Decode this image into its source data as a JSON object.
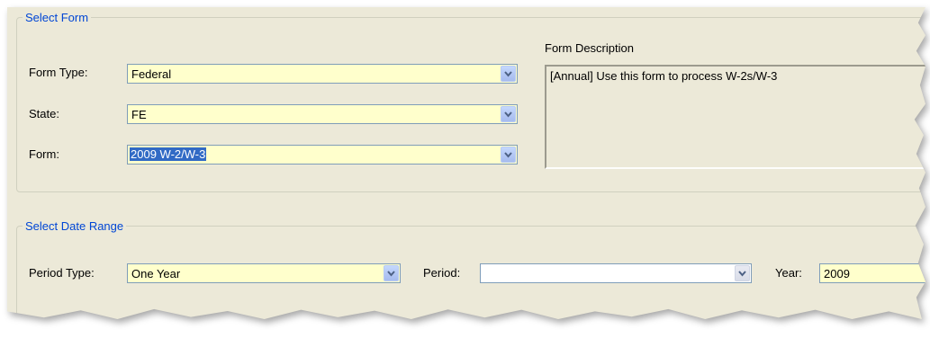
{
  "select_form": {
    "legend": "Select Form",
    "form_type_label": "Form Type:",
    "form_type_value": "Federal",
    "state_label": "State:",
    "state_value": "FE",
    "form_label": "Form:",
    "form_value": "2009 W-2/W-3",
    "description_label": "Form Description",
    "description_text": "[Annual] Use this form to process W-2s/W-3"
  },
  "select_date_range": {
    "legend": "Select Date Range",
    "period_type_label": "Period Type:",
    "period_type_value": "One Year",
    "period_label": "Period:",
    "period_value": "",
    "year_label": "Year:",
    "year_value": "2009"
  },
  "icons": {
    "dropdown": "chevron-down-icon"
  },
  "colors": {
    "legend": "#0046d5",
    "field_background": "#ffffcc",
    "panel_background": "#ece9d8",
    "selection": "#316ac5"
  }
}
